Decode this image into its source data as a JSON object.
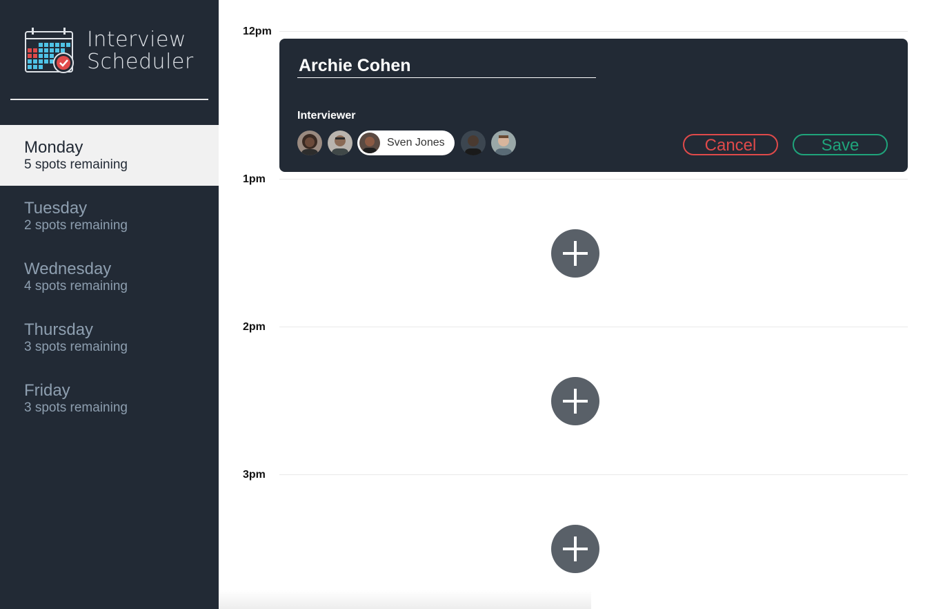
{
  "app": {
    "title_line1": "Interview",
    "title_line2": "Scheduler"
  },
  "sidebar": {
    "days": [
      {
        "name": "Monday",
        "spots": "5 spots remaining",
        "selected": true
      },
      {
        "name": "Tuesday",
        "spots": "2 spots remaining",
        "selected": false
      },
      {
        "name": "Wednesday",
        "spots": "4 spots remaining",
        "selected": false
      },
      {
        "name": "Thursday",
        "spots": "3 spots remaining",
        "selected": false
      },
      {
        "name": "Friday",
        "spots": "3 spots remaining",
        "selected": false
      }
    ]
  },
  "schedule": {
    "slots": [
      {
        "time": "12pm"
      },
      {
        "time": "1pm"
      },
      {
        "time": "2pm"
      },
      {
        "time": "3pm"
      }
    ]
  },
  "form": {
    "student_name": "Archie Cohen",
    "interviewer_label": "Interviewer",
    "selected_interviewer": "Sven Jones",
    "cancel_label": "Cancel",
    "save_label": "Save"
  },
  "colors": {
    "sidebar_bg": "#222a35",
    "cancel": "#e04a4a",
    "save": "#1fa47b",
    "add_button": "#596068"
  }
}
